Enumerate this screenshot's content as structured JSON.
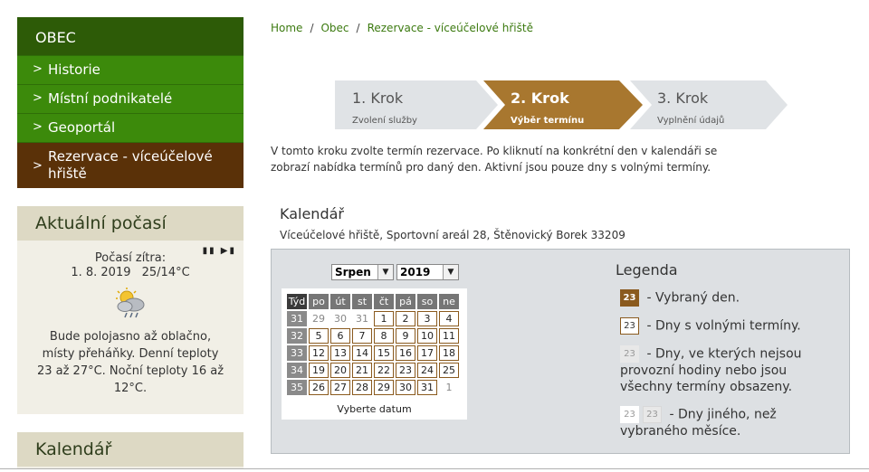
{
  "sidebar": {
    "heading": "OBEC",
    "items": [
      {
        "label": "Historie"
      },
      {
        "label": "Místní podnikatelé"
      },
      {
        "label": "Geoportál"
      },
      {
        "label": "Rezervace - víceúčelové hřiště"
      }
    ]
  },
  "weather": {
    "title": "Aktuální počasí",
    "controls": "▮▮ ▶▮",
    "tomorrow_label": "Počasí zítra:",
    "date": "1. 8. 2019",
    "temps": "25/14°C",
    "icon": "partly-cloudy-rain-icon",
    "description": "Bude polojasno až oblačno, místy přeháňky. Denní teploty 23 až 27°C. Noční teploty 16 až 12°C."
  },
  "calendar_box": {
    "title": "Kalendář"
  },
  "breadcrumb": {
    "items": [
      "Home",
      "Obec",
      "Rezervace - víceúčelové hřiště"
    ],
    "separator": "/"
  },
  "steps": [
    {
      "number": "1. Krok",
      "label": "Zvolení služby"
    },
    {
      "number": "2. Krok",
      "label": "Výběr termínu"
    },
    {
      "number": "3. Krok",
      "label": "Vyplnění údajů"
    }
  ],
  "intro": "V tomto kroku zvolte termín rezervace. Po kliknutí na konkrétní den v kalendáři se zobrazí nabídka termínů pro daný den. Aktivní jsou pouze dny s volnými termíny.",
  "calendar": {
    "title": "Kalendář",
    "subtitle": "Víceúčelové hřiště, Sportovní areál 28, Štěnovický Borek 33209",
    "month": "Srpen",
    "year": "2019",
    "headers": [
      "Týd",
      "po",
      "út",
      "st",
      "čt",
      "pá",
      "so",
      "ne"
    ],
    "weeks": [
      {
        "week": "31",
        "days": [
          {
            "d": "29",
            "t": "other"
          },
          {
            "d": "30",
            "t": "other"
          },
          {
            "d": "31",
            "t": "other"
          },
          {
            "d": "1",
            "t": "free"
          },
          {
            "d": "2",
            "t": "free"
          },
          {
            "d": "3",
            "t": "free"
          },
          {
            "d": "4",
            "t": "free"
          }
        ]
      },
      {
        "week": "32",
        "days": [
          {
            "d": "5",
            "t": "free"
          },
          {
            "d": "6",
            "t": "free"
          },
          {
            "d": "7",
            "t": "free"
          },
          {
            "d": "8",
            "t": "free"
          },
          {
            "d": "9",
            "t": "free"
          },
          {
            "d": "10",
            "t": "free"
          },
          {
            "d": "11",
            "t": "free"
          }
        ]
      },
      {
        "week": "33",
        "days": [
          {
            "d": "12",
            "t": "free"
          },
          {
            "d": "13",
            "t": "free"
          },
          {
            "d": "14",
            "t": "free"
          },
          {
            "d": "15",
            "t": "free"
          },
          {
            "d": "16",
            "t": "free"
          },
          {
            "d": "17",
            "t": "free"
          },
          {
            "d": "18",
            "t": "free"
          }
        ]
      },
      {
        "week": "34",
        "days": [
          {
            "d": "19",
            "t": "free"
          },
          {
            "d": "20",
            "t": "free"
          },
          {
            "d": "21",
            "t": "free"
          },
          {
            "d": "22",
            "t": "free"
          },
          {
            "d": "23",
            "t": "free"
          },
          {
            "d": "24",
            "t": "free"
          },
          {
            "d": "25",
            "t": "free"
          }
        ]
      },
      {
        "week": "35",
        "days": [
          {
            "d": "26",
            "t": "free"
          },
          {
            "d": "27",
            "t": "free"
          },
          {
            "d": "28",
            "t": "free"
          },
          {
            "d": "29",
            "t": "free"
          },
          {
            "d": "30",
            "t": "free"
          },
          {
            "d": "31",
            "t": "free"
          },
          {
            "d": "1",
            "t": "other"
          }
        ]
      }
    ],
    "pick_label": "Vyberte datum"
  },
  "legend": {
    "title": "Legenda",
    "sample_day": "23",
    "rows": [
      {
        "text": "- Vybraný den."
      },
      {
        "text": "- Dny s volnými termíny."
      },
      {
        "text": "- Dny, ve kterých nejsou provozní hodiny nebo jsou všechny termíny obsazeny."
      },
      {
        "text": "- Dny jiného, než vybraného měsíce."
      }
    ]
  },
  "colors": {
    "menu_dark": "#2d5b07",
    "menu_green": "#3c8a0b",
    "menu_active": "#5a3108",
    "step_active": "#a8772f",
    "step_inactive": "#e0e3e6",
    "free_border": "#8a5a1e"
  }
}
